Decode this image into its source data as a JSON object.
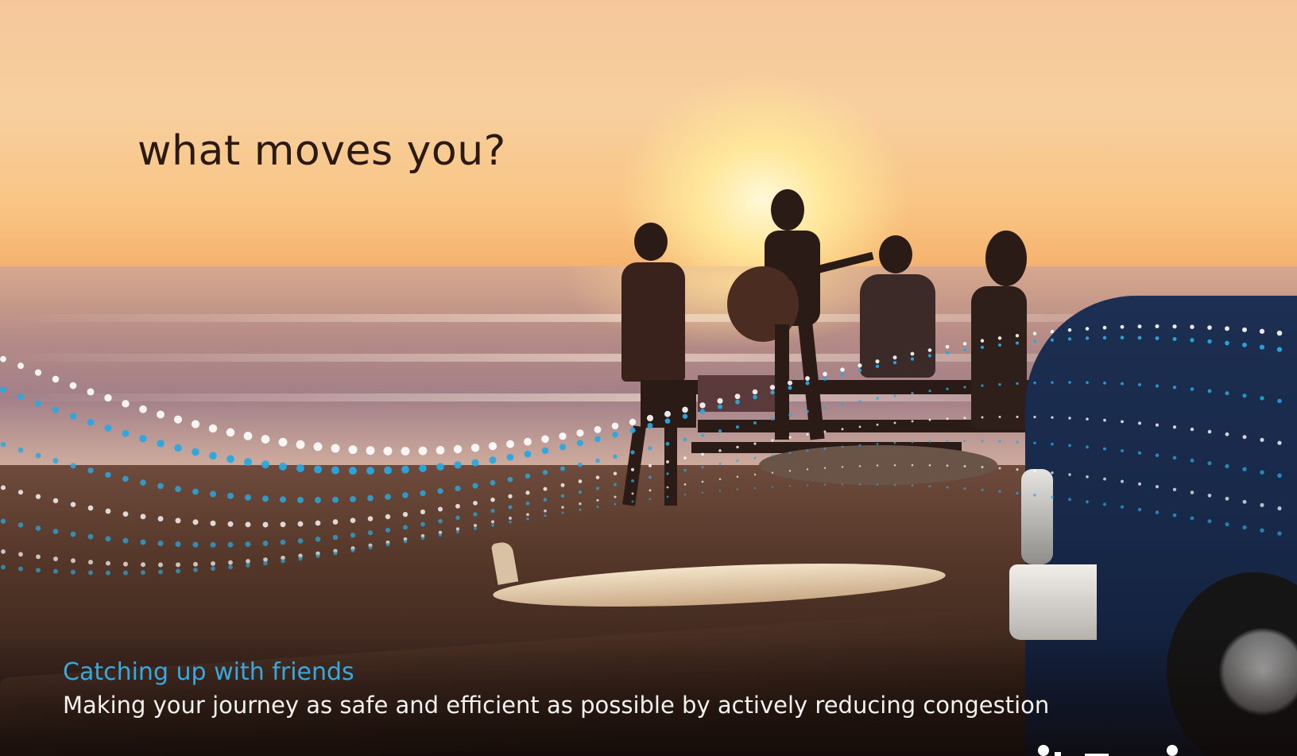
{
  "headline": "what moves you?",
  "caption": {
    "title": "Catching up with friends",
    "body": "Making your journey as safe and efficient as possible by actively reducing congestion"
  },
  "colors": {
    "headline": "#2a1a12",
    "caption_title": "#3aa8e0",
    "caption_body": "#f4f1ee",
    "dot_blue": "#29a8e0",
    "dot_white": "#ffffff",
    "truck": "#1d2f52"
  },
  "icons": {
    "logo": "brand-logo-partial"
  }
}
